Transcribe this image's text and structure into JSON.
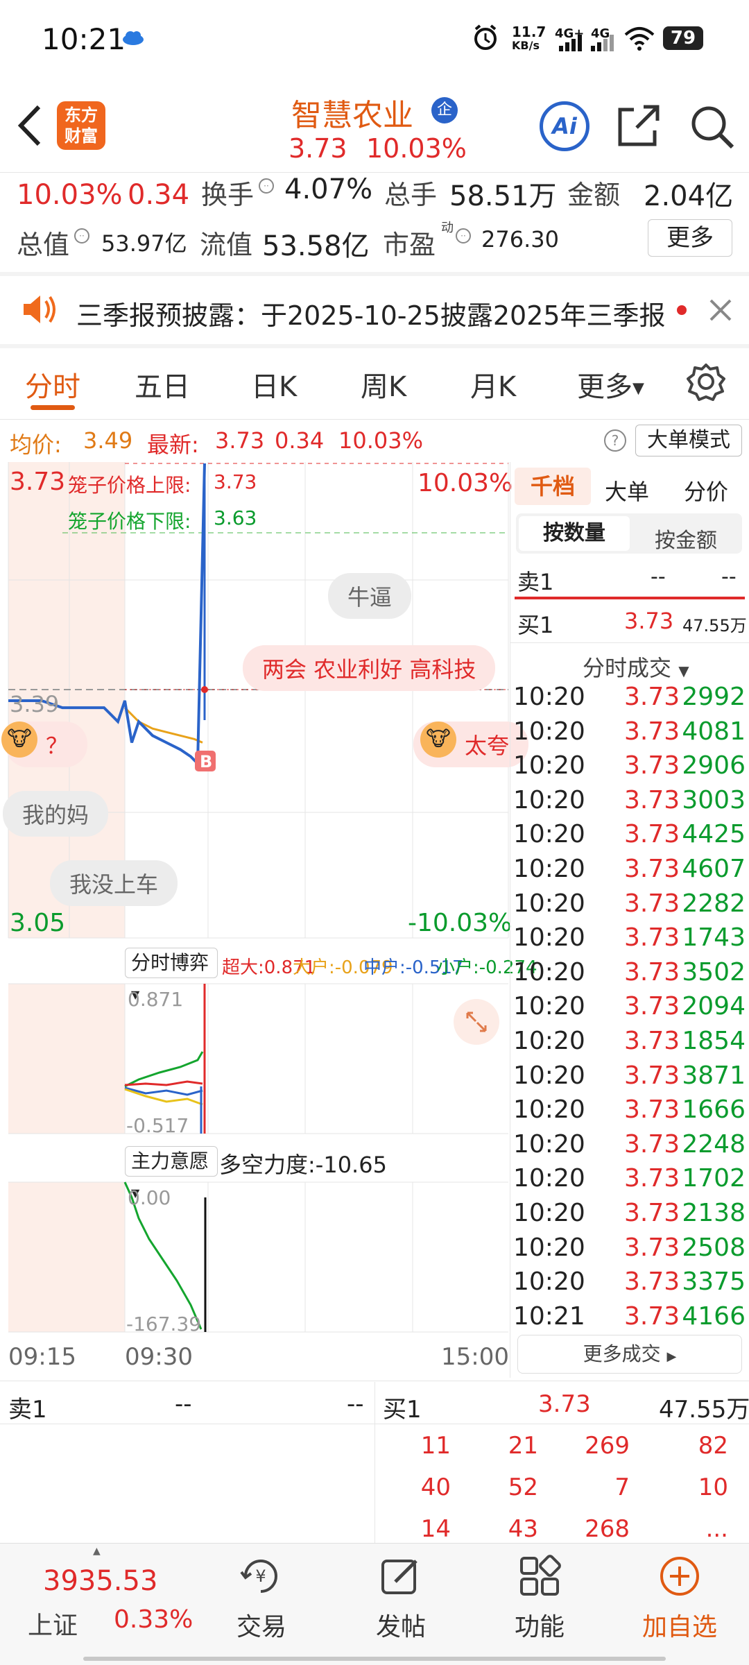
{
  "status": {
    "time": "10:21",
    "speed_top": "11.7",
    "speed_bottom": "KB/s",
    "net1": "4G+",
    "net2": "4G",
    "battery": "79"
  },
  "header": {
    "title": "智慧农业",
    "badge": "企",
    "price": "3.73",
    "change_pct": "10.03%",
    "logo_top": "东方",
    "logo_bottom": "财富",
    "ai": "Ai"
  },
  "quote": {
    "pct": "10.03%",
    "chg": "0.34",
    "turnover_label": "换手",
    "turnover": "4.07%",
    "volume_label": "总手",
    "volume": "58.51万",
    "amount_label": "金额",
    "amount": "2.04亿",
    "mcap_label": "总值",
    "mcap": "53.97亿",
    "float_label": "流值",
    "float": "53.58亿",
    "pe_label": "市盈",
    "pe_sup": "动",
    "pe": "276.30",
    "more": "更多"
  },
  "notice": {
    "text": "三季报预披露：于2025-10-25披露2025年三季报"
  },
  "tabs": [
    "分时",
    "五日",
    "日K",
    "周K",
    "月K",
    "更多"
  ],
  "infobar": {
    "avg_label": "均价:",
    "avg": "3.49",
    "last_label": "最新:",
    "last": "3.73",
    "chg": "0.34",
    "pct": "10.03%",
    "mode": "大单模式"
  },
  "chart": {
    "high": "3.73",
    "low": "3.05",
    "high_pct": "10.03%",
    "low_pct": "-10.03%",
    "cap_up_label": "笼子价格上限:",
    "cap_up": "3.73",
    "cap_down_label": "笼子价格下限:",
    "cap_down": "3.63",
    "prev": "3.39",
    "marker": "B",
    "times": [
      "09:15",
      "09:30",
      "15:00"
    ]
  },
  "barrage": [
    "牛逼",
    "两会 农业利好 高科技",
    "太夸",
    "？",
    "我的妈",
    "我没上车"
  ],
  "game": {
    "label": "分时博弈",
    "super": "超大:0.871",
    "big": "大户:-0.079",
    "mid": "中户:-0.517",
    "small": "小户:-0.274",
    "top": "0.871",
    "bottom": "-0.517"
  },
  "intent": {
    "label": "主力意愿",
    "power": "多空力度:-10.65",
    "top": "0.00",
    "bottom": "-167.39"
  },
  "rightpanel": {
    "tabs": [
      "千档",
      "大单",
      "分价"
    ],
    "subtabs": [
      "按数量",
      "按金额"
    ],
    "sell1": "卖1",
    "sell1_p": "--",
    "sell1_v": "--",
    "buy1": "买1",
    "buy1_p": "3.73",
    "buy1_v": "47.55万",
    "ticks_title": "分时成交",
    "more": "更多成交"
  },
  "ticks": [
    {
      "t": "10:20",
      "p": "3.73",
      "v": "2992"
    },
    {
      "t": "10:20",
      "p": "3.73",
      "v": "4081"
    },
    {
      "t": "10:20",
      "p": "3.73",
      "v": "2906"
    },
    {
      "t": "10:20",
      "p": "3.73",
      "v": "3003"
    },
    {
      "t": "10:20",
      "p": "3.73",
      "v": "4425"
    },
    {
      "t": "10:20",
      "p": "3.73",
      "v": "4607"
    },
    {
      "t": "10:20",
      "p": "3.73",
      "v": "2282"
    },
    {
      "t": "10:20",
      "p": "3.73",
      "v": "1743"
    },
    {
      "t": "10:20",
      "p": "3.73",
      "v": "3502"
    },
    {
      "t": "10:20",
      "p": "3.73",
      "v": "2094"
    },
    {
      "t": "10:20",
      "p": "3.73",
      "v": "1854"
    },
    {
      "t": "10:20",
      "p": "3.73",
      "v": "3871"
    },
    {
      "t": "10:20",
      "p": "3.73",
      "v": "1666"
    },
    {
      "t": "10:20",
      "p": "3.73",
      "v": "2248"
    },
    {
      "t": "10:20",
      "p": "3.73",
      "v": "1702"
    },
    {
      "t": "10:20",
      "p": "3.73",
      "v": "2138"
    },
    {
      "t": "10:20",
      "p": "3.73",
      "v": "2508"
    },
    {
      "t": "10:20",
      "p": "3.73",
      "v": "3375"
    },
    {
      "t": "10:21",
      "p": "3.73",
      "v": "4166"
    }
  ],
  "book": {
    "sell_label": "卖1",
    "sell_p": "--",
    "sell_v": "--",
    "buy_label": "买1",
    "buy_p": "3.73",
    "buy_v": "47.55万",
    "rows": [
      [
        "11",
        "21",
        "269",
        "82"
      ],
      [
        "40",
        "52",
        "7",
        "10"
      ],
      [
        "14",
        "43",
        "268",
        "..."
      ]
    ]
  },
  "bottomnav": {
    "index_value": "3935.53",
    "index_name": "上证",
    "index_pct": "0.33%",
    "items": [
      "交易",
      "发帖",
      "功能",
      "加自选"
    ]
  },
  "colors": {
    "accent": "#e05a12",
    "up": "#e02a2a",
    "down": "#0a9b2d",
    "price_line": "#2a63c9",
    "avg_line": "#e8a21a"
  }
}
